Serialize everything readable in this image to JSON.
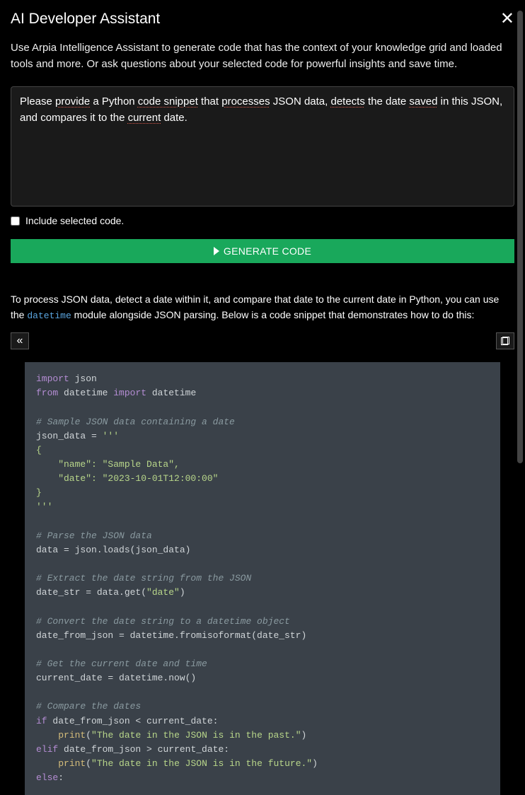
{
  "header": {
    "title": "AI Developer Assistant"
  },
  "description": "Use Arpia Intelligence Assistant to generate code that has the context of your knowledge grid and loaded tools and more. Or ask questions about your selected code for powerful insights and save time.",
  "input": {
    "text_parts": [
      "Please ",
      "provide",
      " a Python ",
      "code snippet",
      " that ",
      "processes",
      " JSON data, ",
      "detects",
      " the date ",
      "saved",
      " in this JSON, and compares it to the ",
      "current",
      " date."
    ],
    "spellcheck_indices": [
      1,
      3,
      5,
      7,
      9,
      11
    ]
  },
  "checkbox": {
    "label": "Include selected code.",
    "checked": false
  },
  "button": {
    "label": "GENERATE CODE"
  },
  "response": {
    "intro_before": "To process JSON data, detect a date within it, and compare that date to the current date in Python, you can use the ",
    "intro_code": "datetime",
    "intro_after": " module alongside JSON parsing. Below is a code snippet that demonstrates how to do this:"
  },
  "code": {
    "lines": [
      {
        "tokens": [
          {
            "t": "import",
            "c": "kw-import"
          },
          {
            "t": " json",
            "c": "plain"
          }
        ]
      },
      {
        "tokens": [
          {
            "t": "from",
            "c": "kw-from"
          },
          {
            "t": " datetime ",
            "c": "plain"
          },
          {
            "t": "import",
            "c": "kw-import"
          },
          {
            "t": " datetime",
            "c": "plain"
          }
        ]
      },
      {
        "tokens": []
      },
      {
        "tokens": [
          {
            "t": "# Sample JSON data containing a date",
            "c": "comment"
          }
        ]
      },
      {
        "tokens": [
          {
            "t": "json_data = ",
            "c": "plain"
          },
          {
            "t": "'''",
            "c": "string"
          }
        ]
      },
      {
        "tokens": [
          {
            "t": "{",
            "c": "string"
          }
        ]
      },
      {
        "tokens": [
          {
            "t": "    \"name\": \"Sample Data\",",
            "c": "string"
          }
        ]
      },
      {
        "tokens": [
          {
            "t": "    \"date\": \"2023-10-01T12:00:00\"",
            "c": "string"
          }
        ]
      },
      {
        "tokens": [
          {
            "t": "}",
            "c": "string"
          }
        ]
      },
      {
        "tokens": [
          {
            "t": "'''",
            "c": "string"
          }
        ]
      },
      {
        "tokens": []
      },
      {
        "tokens": [
          {
            "t": "# Parse the JSON data",
            "c": "comment"
          }
        ]
      },
      {
        "tokens": [
          {
            "t": "data = json.loads(json_data)",
            "c": "plain"
          }
        ]
      },
      {
        "tokens": []
      },
      {
        "tokens": [
          {
            "t": "# Extract the date string from the JSON",
            "c": "comment"
          }
        ]
      },
      {
        "tokens": [
          {
            "t": "date_str = data.get(",
            "c": "plain"
          },
          {
            "t": "\"date\"",
            "c": "string"
          },
          {
            "t": ")",
            "c": "plain"
          }
        ]
      },
      {
        "tokens": []
      },
      {
        "tokens": [
          {
            "t": "# Convert the date string to a datetime object",
            "c": "comment"
          }
        ]
      },
      {
        "tokens": [
          {
            "t": "date_from_json = datetime.fromisoformat(date_str)",
            "c": "plain"
          }
        ]
      },
      {
        "tokens": []
      },
      {
        "tokens": [
          {
            "t": "# Get the current date and time",
            "c": "comment"
          }
        ]
      },
      {
        "tokens": [
          {
            "t": "current_date = datetime.now()",
            "c": "plain"
          }
        ]
      },
      {
        "tokens": []
      },
      {
        "tokens": [
          {
            "t": "# Compare the dates",
            "c": "comment"
          }
        ]
      },
      {
        "tokens": [
          {
            "t": "if",
            "c": "kw-if"
          },
          {
            "t": " date_from_json < current_date:",
            "c": "plain"
          }
        ]
      },
      {
        "tokens": [
          {
            "t": "    ",
            "c": "plain"
          },
          {
            "t": "print",
            "c": "builtin"
          },
          {
            "t": "(",
            "c": "plain"
          },
          {
            "t": "\"The date in the JSON is in the past.\"",
            "c": "string"
          },
          {
            "t": ")",
            "c": "plain"
          }
        ]
      },
      {
        "tokens": [
          {
            "t": "elif",
            "c": "kw-elif"
          },
          {
            "t": " date_from_json > current_date:",
            "c": "plain"
          }
        ]
      },
      {
        "tokens": [
          {
            "t": "    ",
            "c": "plain"
          },
          {
            "t": "print",
            "c": "builtin"
          },
          {
            "t": "(",
            "c": "plain"
          },
          {
            "t": "\"The date in the JSON is in the future.\"",
            "c": "string"
          },
          {
            "t": ")",
            "c": "plain"
          }
        ]
      },
      {
        "tokens": [
          {
            "t": "else",
            "c": "kw-else"
          },
          {
            "t": ":",
            "c": "plain"
          }
        ]
      }
    ]
  }
}
